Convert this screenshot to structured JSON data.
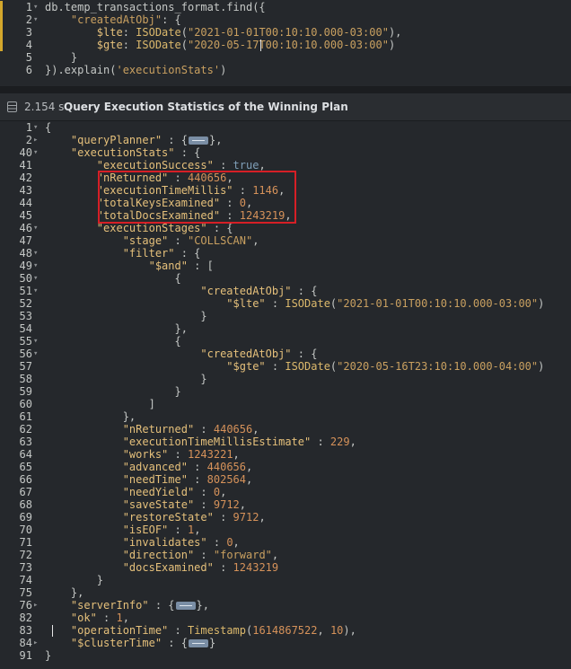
{
  "editor": {
    "lines": [
      {
        "num": "1",
        "fold": "▾",
        "mark": true,
        "segments": [
          {
            "t": "db.temp_transactions_format.find({",
            "c": "v"
          }
        ]
      },
      {
        "num": "2",
        "fold": "▾",
        "mark": true,
        "segments": [
          {
            "t": "    ",
            "c": "v"
          },
          {
            "t": "\"createdAtObj\"",
            "c": "s"
          },
          {
            "t": ": {",
            "c": "v"
          }
        ]
      },
      {
        "num": "3",
        "fold": "",
        "mark": true,
        "segments": [
          {
            "t": "        ",
            "c": "v"
          },
          {
            "t": "$lte",
            "c": "k"
          },
          {
            "t": ": ",
            "c": "v"
          },
          {
            "t": "ISODate",
            "c": "fn"
          },
          {
            "t": "(",
            "c": "v"
          },
          {
            "t": "\"2021-01-01T00:10:10.000-03:00\"",
            "c": "s"
          },
          {
            "t": "),",
            "c": "v"
          }
        ]
      },
      {
        "num": "4",
        "fold": "",
        "mark": true,
        "segments": [
          {
            "t": "        ",
            "c": "v"
          },
          {
            "t": "$gte",
            "c": "k"
          },
          {
            "t": ": ",
            "c": "v"
          },
          {
            "t": "ISODate",
            "c": "fn"
          },
          {
            "t": "(",
            "c": "v"
          },
          {
            "t": "\"2020-05-17T00:10:10.000-03:00\"",
            "c": "s"
          },
          {
            "t": ")",
            "c": "v"
          }
        ]
      },
      {
        "num": "5",
        "fold": "",
        "mark": false,
        "segments": [
          {
            "t": "    }",
            "c": "v"
          }
        ]
      },
      {
        "num": "6",
        "fold": "",
        "mark": false,
        "segments": [
          {
            "t": "}).explain(",
            "c": "v"
          },
          {
            "t": "'executionStats'",
            "c": "s"
          },
          {
            "t": ")",
            "c": "v"
          }
        ]
      }
    ]
  },
  "result": {
    "exec_time": "2.154 s",
    "title": "Query Execution Statistics of the Winning Plan",
    "lines": [
      {
        "num": "1",
        "fold": "▾",
        "segments": [
          {
            "t": "{",
            "c": "v"
          }
        ]
      },
      {
        "num": "2",
        "fold": "▸",
        "segments": [
          {
            "t": "    ",
            "c": "v"
          },
          {
            "t": "\"queryPlanner\"",
            "c": "k"
          },
          {
            "t": " : {",
            "c": "v"
          },
          {
            "ph": true
          },
          {
            "t": "},",
            "c": "v"
          }
        ]
      },
      {
        "num": "40",
        "fold": "▾",
        "segments": [
          {
            "t": "    ",
            "c": "v"
          },
          {
            "t": "\"executionStats\"",
            "c": "k"
          },
          {
            "t": " : {",
            "c": "v"
          }
        ]
      },
      {
        "num": "41",
        "fold": "",
        "segments": [
          {
            "t": "        ",
            "c": "v"
          },
          {
            "t": "\"executionSuccess\"",
            "c": "k"
          },
          {
            "t": " : ",
            "c": "v"
          },
          {
            "t": "true",
            "c": "kw"
          },
          {
            "t": ",",
            "c": "v"
          }
        ]
      },
      {
        "num": "42",
        "fold": "",
        "segments": [
          {
            "t": "        ",
            "c": "v"
          },
          {
            "t": "\"nReturned\"",
            "c": "k"
          },
          {
            "t": " : ",
            "c": "v"
          },
          {
            "t": "440656",
            "c": "n"
          },
          {
            "t": ",",
            "c": "v"
          }
        ]
      },
      {
        "num": "43",
        "fold": "",
        "segments": [
          {
            "t": "        ",
            "c": "v"
          },
          {
            "t": "\"executionTimeMillis\"",
            "c": "k"
          },
          {
            "t": " : ",
            "c": "v"
          },
          {
            "t": "1146",
            "c": "n"
          },
          {
            "t": ",",
            "c": "v"
          }
        ]
      },
      {
        "num": "44",
        "fold": "",
        "segments": [
          {
            "t": "        ",
            "c": "v"
          },
          {
            "t": "\"totalKeysExamined\"",
            "c": "k"
          },
          {
            "t": " : ",
            "c": "v"
          },
          {
            "t": "0",
            "c": "n"
          },
          {
            "t": ",",
            "c": "v"
          }
        ]
      },
      {
        "num": "45",
        "fold": "",
        "segments": [
          {
            "t": "        ",
            "c": "v"
          },
          {
            "t": "\"totalDocsExamined\"",
            "c": "k"
          },
          {
            "t": " : ",
            "c": "v"
          },
          {
            "t": "1243219",
            "c": "n"
          },
          {
            "t": ",",
            "c": "v"
          }
        ]
      },
      {
        "num": "46",
        "fold": "▾",
        "segments": [
          {
            "t": "        ",
            "c": "v"
          },
          {
            "t": "\"executionStages\"",
            "c": "k"
          },
          {
            "t": " : {",
            "c": "v"
          }
        ]
      },
      {
        "num": "47",
        "fold": "",
        "segments": [
          {
            "t": "            ",
            "c": "v"
          },
          {
            "t": "\"stage\"",
            "c": "k"
          },
          {
            "t": " : ",
            "c": "v"
          },
          {
            "t": "\"COLLSCAN\"",
            "c": "s"
          },
          {
            "t": ",",
            "c": "v"
          }
        ]
      },
      {
        "num": "48",
        "fold": "▾",
        "segments": [
          {
            "t": "            ",
            "c": "v"
          },
          {
            "t": "\"filter\"",
            "c": "k"
          },
          {
            "t": " : {",
            "c": "v"
          }
        ]
      },
      {
        "num": "49",
        "fold": "▾",
        "segments": [
          {
            "t": "                ",
            "c": "v"
          },
          {
            "t": "\"$and\"",
            "c": "k"
          },
          {
            "t": " : [",
            "c": "v"
          }
        ]
      },
      {
        "num": "50",
        "fold": "▾",
        "segments": [
          {
            "t": "                    {",
            "c": "v"
          }
        ]
      },
      {
        "num": "51",
        "fold": "▾",
        "segments": [
          {
            "t": "                        ",
            "c": "v"
          },
          {
            "t": "\"createdAtObj\"",
            "c": "k"
          },
          {
            "t": " : {",
            "c": "v"
          }
        ]
      },
      {
        "num": "52",
        "fold": "",
        "segments": [
          {
            "t": "                            ",
            "c": "v"
          },
          {
            "t": "\"$lte\"",
            "c": "k"
          },
          {
            "t": " : ",
            "c": "v"
          },
          {
            "t": "ISODate",
            "c": "fn"
          },
          {
            "t": "(",
            "c": "v"
          },
          {
            "t": "\"2021-01-01T00:10:10.000-03:00\"",
            "c": "s"
          },
          {
            "t": ")",
            "c": "v"
          }
        ]
      },
      {
        "num": "53",
        "fold": "",
        "segments": [
          {
            "t": "                        }",
            "c": "v"
          }
        ]
      },
      {
        "num": "54",
        "fold": "",
        "segments": [
          {
            "t": "                    },",
            "c": "v"
          }
        ]
      },
      {
        "num": "55",
        "fold": "▾",
        "segments": [
          {
            "t": "                    {",
            "c": "v"
          }
        ]
      },
      {
        "num": "56",
        "fold": "▾",
        "segments": [
          {
            "t": "                        ",
            "c": "v"
          },
          {
            "t": "\"createdAtObj\"",
            "c": "k"
          },
          {
            "t": " : {",
            "c": "v"
          }
        ]
      },
      {
        "num": "57",
        "fold": "",
        "segments": [
          {
            "t": "                            ",
            "c": "v"
          },
          {
            "t": "\"$gte\"",
            "c": "k"
          },
          {
            "t": " : ",
            "c": "v"
          },
          {
            "t": "ISODate",
            "c": "fn"
          },
          {
            "t": "(",
            "c": "v"
          },
          {
            "t": "\"2020-05-16T23:10:10.000-04:00\"",
            "c": "s"
          },
          {
            "t": ")",
            "c": "v"
          }
        ]
      },
      {
        "num": "58",
        "fold": "",
        "segments": [
          {
            "t": "                        }",
            "c": "v"
          }
        ]
      },
      {
        "num": "59",
        "fold": "",
        "segments": [
          {
            "t": "                    }",
            "c": "v"
          }
        ]
      },
      {
        "num": "60",
        "fold": "",
        "segments": [
          {
            "t": "                ]",
            "c": "v"
          }
        ]
      },
      {
        "num": "61",
        "fold": "",
        "segments": [
          {
            "t": "            },",
            "c": "v"
          }
        ]
      },
      {
        "num": "62",
        "fold": "",
        "segments": [
          {
            "t": "            ",
            "c": "v"
          },
          {
            "t": "\"nReturned\"",
            "c": "k"
          },
          {
            "t": " : ",
            "c": "v"
          },
          {
            "t": "440656",
            "c": "n"
          },
          {
            "t": ",",
            "c": "v"
          }
        ]
      },
      {
        "num": "63",
        "fold": "",
        "segments": [
          {
            "t": "            ",
            "c": "v"
          },
          {
            "t": "\"executionTimeMillisEstimate\"",
            "c": "k"
          },
          {
            "t": " : ",
            "c": "v"
          },
          {
            "t": "229",
            "c": "n"
          },
          {
            "t": ",",
            "c": "v"
          }
        ]
      },
      {
        "num": "64",
        "fold": "",
        "segments": [
          {
            "t": "            ",
            "c": "v"
          },
          {
            "t": "\"works\"",
            "c": "k"
          },
          {
            "t": " : ",
            "c": "v"
          },
          {
            "t": "1243221",
            "c": "n"
          },
          {
            "t": ",",
            "c": "v"
          }
        ]
      },
      {
        "num": "65",
        "fold": "",
        "segments": [
          {
            "t": "            ",
            "c": "v"
          },
          {
            "t": "\"advanced\"",
            "c": "k"
          },
          {
            "t": " : ",
            "c": "v"
          },
          {
            "t": "440656",
            "c": "n"
          },
          {
            "t": ",",
            "c": "v"
          }
        ]
      },
      {
        "num": "66",
        "fold": "",
        "segments": [
          {
            "t": "            ",
            "c": "v"
          },
          {
            "t": "\"needTime\"",
            "c": "k"
          },
          {
            "t": " : ",
            "c": "v"
          },
          {
            "t": "802564",
            "c": "n"
          },
          {
            "t": ",",
            "c": "v"
          }
        ]
      },
      {
        "num": "67",
        "fold": "",
        "segments": [
          {
            "t": "            ",
            "c": "v"
          },
          {
            "t": "\"needYield\"",
            "c": "k"
          },
          {
            "t": " : ",
            "c": "v"
          },
          {
            "t": "0",
            "c": "n"
          },
          {
            "t": ",",
            "c": "v"
          }
        ]
      },
      {
        "num": "68",
        "fold": "",
        "segments": [
          {
            "t": "            ",
            "c": "v"
          },
          {
            "t": "\"saveState\"",
            "c": "k"
          },
          {
            "t": " : ",
            "c": "v"
          },
          {
            "t": "9712",
            "c": "n"
          },
          {
            "t": ",",
            "c": "v"
          }
        ]
      },
      {
        "num": "69",
        "fold": "",
        "segments": [
          {
            "t": "            ",
            "c": "v"
          },
          {
            "t": "\"restoreState\"",
            "c": "k"
          },
          {
            "t": " : ",
            "c": "v"
          },
          {
            "t": "9712",
            "c": "n"
          },
          {
            "t": ",",
            "c": "v"
          }
        ]
      },
      {
        "num": "70",
        "fold": "",
        "segments": [
          {
            "t": "            ",
            "c": "v"
          },
          {
            "t": "\"isEOF\"",
            "c": "k"
          },
          {
            "t": " : ",
            "c": "v"
          },
          {
            "t": "1",
            "c": "n"
          },
          {
            "t": ",",
            "c": "v"
          }
        ]
      },
      {
        "num": "71",
        "fold": "",
        "segments": [
          {
            "t": "            ",
            "c": "v"
          },
          {
            "t": "\"invalidates\"",
            "c": "k"
          },
          {
            "t": " : ",
            "c": "v"
          },
          {
            "t": "0",
            "c": "n"
          },
          {
            "t": ",",
            "c": "v"
          }
        ]
      },
      {
        "num": "72",
        "fold": "",
        "segments": [
          {
            "t": "            ",
            "c": "v"
          },
          {
            "t": "\"direction\"",
            "c": "k"
          },
          {
            "t": " : ",
            "c": "v"
          },
          {
            "t": "\"forward\"",
            "c": "s"
          },
          {
            "t": ",",
            "c": "v"
          }
        ]
      },
      {
        "num": "73",
        "fold": "",
        "segments": [
          {
            "t": "            ",
            "c": "v"
          },
          {
            "t": "\"docsExamined\"",
            "c": "k"
          },
          {
            "t": " : ",
            "c": "v"
          },
          {
            "t": "1243219",
            "c": "n"
          }
        ]
      },
      {
        "num": "74",
        "fold": "",
        "segments": [
          {
            "t": "        }",
            "c": "v"
          }
        ]
      },
      {
        "num": "75",
        "fold": "",
        "segments": [
          {
            "t": "    },",
            "c": "v"
          }
        ]
      },
      {
        "num": "76",
        "fold": "▸",
        "segments": [
          {
            "t": "    ",
            "c": "v"
          },
          {
            "t": "\"serverInfo\"",
            "c": "k"
          },
          {
            "t": " : {",
            "c": "v"
          },
          {
            "ph": true
          },
          {
            "t": "},",
            "c": "v"
          }
        ]
      },
      {
        "num": "82",
        "fold": "",
        "segments": [
          {
            "t": "    ",
            "c": "v"
          },
          {
            "t": "\"ok\"",
            "c": "k"
          },
          {
            "t": " : ",
            "c": "v"
          },
          {
            "t": "1",
            "c": "n"
          },
          {
            "t": ",",
            "c": "v"
          }
        ]
      },
      {
        "num": "83",
        "fold": "",
        "segments": [
          {
            "t": "    ",
            "c": "v"
          },
          {
            "t": "\"operationTime\"",
            "c": "k"
          },
          {
            "t": " : ",
            "c": "v"
          },
          {
            "t": "Timestamp",
            "c": "fn"
          },
          {
            "t": "(",
            "c": "v"
          },
          {
            "t": "1614867522",
            "c": "n"
          },
          {
            "t": ", ",
            "c": "v"
          },
          {
            "t": "10",
            "c": "n"
          },
          {
            "t": "),",
            "c": "v"
          }
        ]
      },
      {
        "num": "84",
        "fold": "▸",
        "segments": [
          {
            "t": "    ",
            "c": "v"
          },
          {
            "t": "\"$clusterTime\"",
            "c": "k"
          },
          {
            "t": " : {",
            "c": "v"
          },
          {
            "ph": true
          },
          {
            "t": "}",
            "c": "v"
          }
        ]
      },
      {
        "num": "91",
        "fold": "",
        "segments": [
          {
            "t": "}",
            "c": "v"
          }
        ]
      }
    ]
  }
}
